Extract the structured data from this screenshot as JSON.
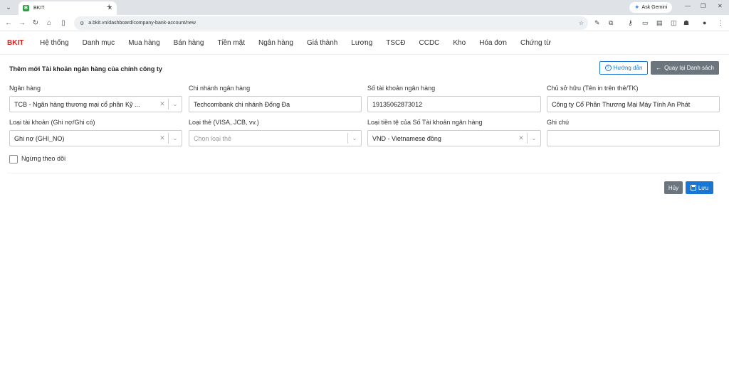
{
  "browser": {
    "tab_title": "BKIT",
    "favicon_letter": "B",
    "url": "a.bkit.vn/dashboard/company-bank-account/new",
    "gemini_label": "Ask Gemini"
  },
  "nav": {
    "brand": "BKIT",
    "items": [
      "Hệ thống",
      "Danh mục",
      "Mua hàng",
      "Bán hàng",
      "Tiền mặt",
      "Ngân hàng",
      "Giá thành",
      "Lương",
      "TSCĐ",
      "CCDC",
      "Kho",
      "Hóa đơn",
      "Chứng từ"
    ]
  },
  "page": {
    "title": "Thêm mới Tài khoản ngân hàng của chính công ty",
    "guide_label": "Hướng dẫn",
    "back_label": "Quay lại Danh sách"
  },
  "form": {
    "bank": {
      "label": "Ngân hàng",
      "value": "TCB - Ngân hàng thương mại cổ phần Kỹ ..."
    },
    "branch": {
      "label": "Chi nhánh ngân hàng",
      "value": "Techcombank chi nhánh Đống Đa"
    },
    "account_number": {
      "label": "Số tài khoản ngân hàng",
      "value": "19135062873012"
    },
    "owner": {
      "label": "Chủ sở hữu (Tên in trên thẻ/TK)",
      "value": "Công ty Cổ Phần Thương Mại Máy Tính An Phát"
    },
    "account_type": {
      "label": "Loại tài khoản (Ghi nợ/Ghi có)",
      "value": "Ghi nợ (GHI_NO)"
    },
    "card_type": {
      "label": "Loại thẻ (VISA, JCB, vv.)",
      "placeholder": "Chọn loại thẻ"
    },
    "currency": {
      "label": "Loại tiền tệ của Số Tài khoản ngân hàng",
      "value": "VND - Vietnamese đồng"
    },
    "note": {
      "label": "Ghi chú",
      "value": ""
    },
    "stop_tracking": {
      "label": "Ngừng theo dõi",
      "checked": false
    }
  },
  "actions": {
    "cancel_label": "Hủy",
    "save_label": "Lưu"
  },
  "colors": {
    "brand": "#e31b1b",
    "primary": "#1976d2",
    "secondary": "#6c757d"
  }
}
